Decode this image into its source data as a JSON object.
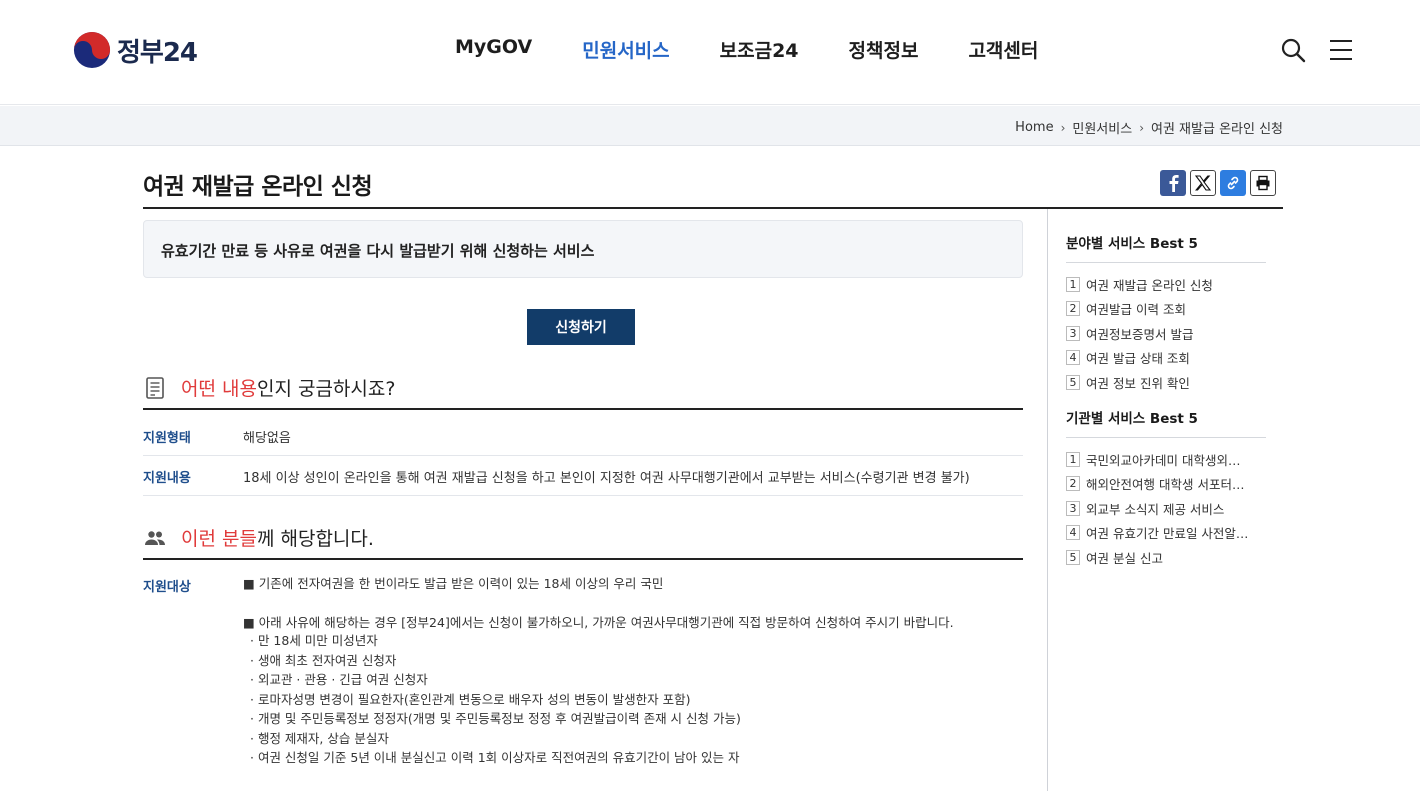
{
  "header": {
    "logo_text": "정부24",
    "nav": [
      "MyGOV",
      "민원서비스",
      "보조금24",
      "정책정보",
      "고객센터"
    ],
    "active_nav": "민원서비스"
  },
  "breadcrumb": [
    "Home",
    "민원서비스",
    "여권 재발급 온라인 신청"
  ],
  "page": {
    "title": "여권 재발급 온라인 신청",
    "summary": "유효기간 만료 등 사유로 여권을 다시 발급받기 위해 신청하는 서비스",
    "apply_label": "신청하기"
  },
  "section1": {
    "highlight": "어떤 내용",
    "rest": "인지 궁금하시죠?",
    "rows": [
      {
        "label": "지원형태",
        "value": "해당없음"
      },
      {
        "label": "지원내용",
        "value": "18세 이상 성인이 온라인을 통해 여권 재발급 신청을 하고 본인이 지정한 여권 사무대행기관에서 교부받는 서비스(수령기관 변경 불가)"
      }
    ]
  },
  "section2": {
    "highlight": "이런 분들",
    "rest": "께 해당합니다.",
    "label": "지원대상",
    "line1": "■ 기존에 전자여권을 한 번이라도 발급 받은 이력이 있는 18세 이상의 우리 국민",
    "line2": "■ 아래 사유에 해당하는 경우 [정부24]에서는 신청이 불가하오니, 가까운 여권사무대행기관에 직접 방문하여 신청하여 주시기 바랍니다.",
    "subs": [
      "· 만 18세 미만 미성년자",
      "· 생애 최초 전자여권 신청자",
      "· 외교관 · 관용 · 긴급 여권 신청자",
      "· 로마자성명 변경이 필요한자(혼인관계 변동으로 배우자 성의 변동이 발생한자 포함)",
      "· 개명 및 주민등록정보 정정자(개명 및 주민등록정보 정정 후 여권발급이력 존재 시 신청 가능)",
      "· 행정 제재자, 상습 분실자",
      "· 여권 신청일 기준 5년 이내 분실신고 이력 1회 이상자로 직전여권의 유효기간이 남아 있는 자"
    ]
  },
  "sidebar": {
    "field_title": "분야별 서비스 Best 5",
    "field_items": [
      "여권 재발급 온라인 신청",
      "여권발급 이력 조회",
      "여권정보증명서 발급",
      "여권 발급 상태 조회",
      "여권 정보 진위 확인"
    ],
    "agency_title": "기관별 서비스 Best 5",
    "agency_items": [
      "국민외교아카데미 대학생외교…",
      "해외안전여행 대학생 서포터스…",
      "외교부 소식지 제공 서비스",
      "여권 유효기간 만료일 사전알…",
      "여권 분실 신고"
    ],
    "nums": [
      "1",
      "2",
      "3",
      "4",
      "5"
    ]
  },
  "colors": {
    "accent": "#2566c7",
    "highlight": "#e03b3b",
    "button": "#123c69"
  }
}
